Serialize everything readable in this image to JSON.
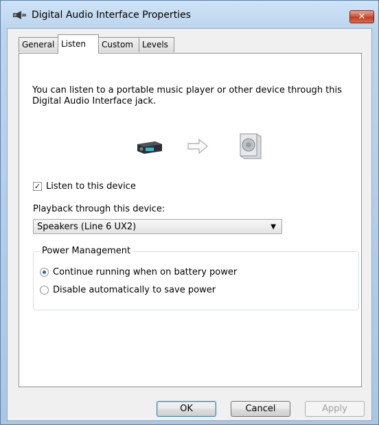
{
  "window": {
    "title": "Digital Audio Interface Properties",
    "close_glyph": "✕",
    "icon": "speaker-device-icon"
  },
  "tabs": [
    {
      "label": "General",
      "active": false
    },
    {
      "label": "Listen",
      "active": true
    },
    {
      "label": "Custom",
      "active": false
    },
    {
      "label": "Levels",
      "active": false
    }
  ],
  "listen": {
    "description": "You can listen to a portable music player or other device through this Digital Audio Interface jack.",
    "icons": [
      "audio-device-icon",
      "arrow-right-icon",
      "speaker-icon"
    ],
    "listen_checkbox": {
      "label": "Listen to this device",
      "checked": true,
      "glyph": "✓"
    },
    "playback_label": "Playback through this device:",
    "playback_select": {
      "value": "Speakers (Line 6 UX2)",
      "arrow": "▼"
    },
    "power": {
      "title": "Power Management",
      "options": [
        {
          "label": "Continue running when on battery power",
          "selected": true
        },
        {
          "label": "Disable automatically to save power",
          "selected": false
        }
      ]
    }
  },
  "buttons": {
    "ok": "OK",
    "cancel": "Cancel",
    "apply": "Apply"
  },
  "colors": {
    "frame": "#bcd5ee",
    "close": "#c43b22",
    "radio_selected": "#2a5fa8"
  }
}
